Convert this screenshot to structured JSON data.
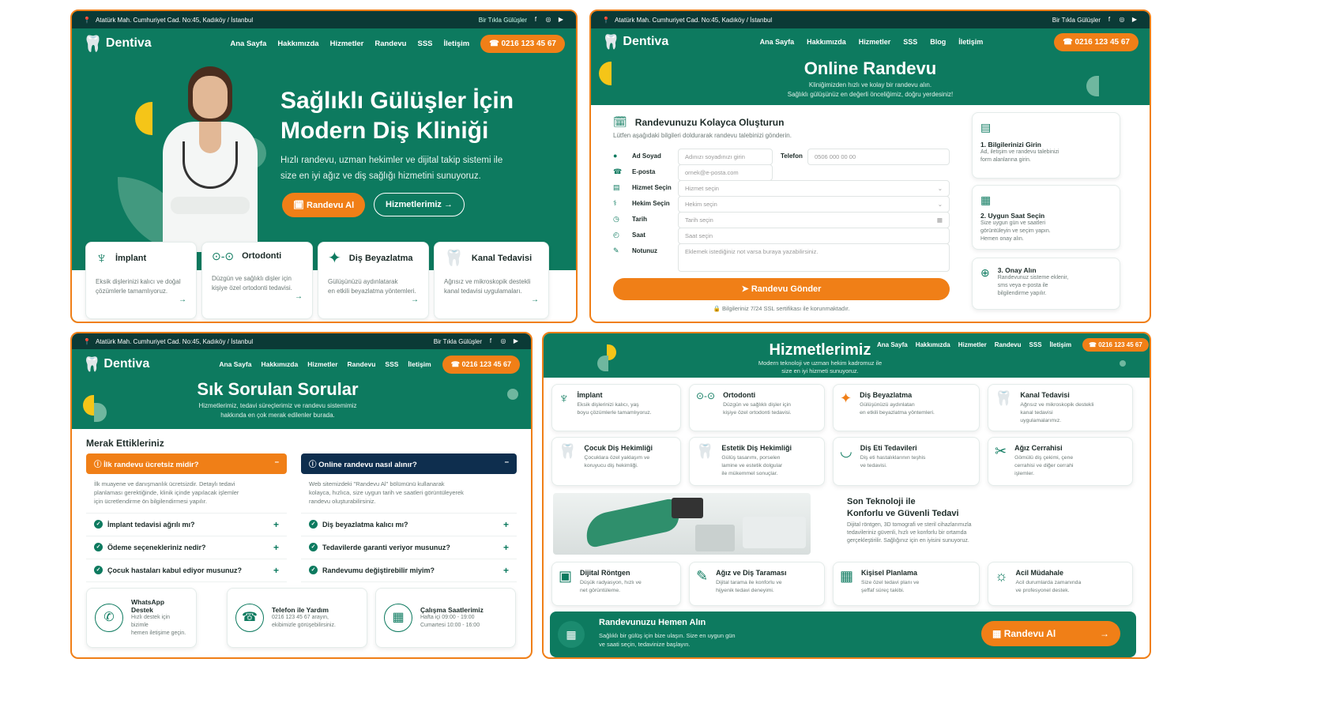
{
  "topbar": {
    "address": "Atatürk Mah. Cumhuriyet Cad. No:45, Kadıköy / İstanbul",
    "slogan": "Bir Tıkla Gülüşler"
  },
  "brand": "Dentiva",
  "phone": "0216 123 45 67",
  "nav1": [
    "Ana Sayfa",
    "Hakkımızda",
    "Hizmetler",
    "Randevu",
    "SSS",
    "İletişim"
  ],
  "nav2": [
    "Ana Sayfa",
    "Hakkımızda",
    "Hizmetler",
    "SSS",
    "Blog",
    "İletişim"
  ],
  "hero": {
    "title1": "Sağlıklı Gülüşler İçin",
    "title2": "Modern Diş Kliniği",
    "desc1": "Hızlı randevu, uzman hekimler ve dijital takip sistemi ile",
    "desc2": "size en iyi ağız ve diş sağlığı hizmetini sunuyoruz.",
    "btn1": "Randevu Al",
    "btn2": "Hizmetlerimiz"
  },
  "hero_cards": [
    {
      "title": "İmplant",
      "d1": "Eksik dişlerinizi kalıcı ve doğal",
      "d2": "çözümlerle tamamlıyoruz."
    },
    {
      "title": "Ortodonti",
      "d1": "Düzgün ve sağlıklı dişler için",
      "d2": "kişiye özel ortodonti tedavisi."
    },
    {
      "title": "Diş Beyazlatma",
      "d1": "Gülüşünüzü aydınlatarak",
      "d2": "en etkili beyazlatma yöntemleri."
    },
    {
      "title": "Kanal Tedavisi",
      "d1": "Ağrısız ve mikroskopik destekli",
      "d2": "kanal tedavisi uygulamaları."
    }
  ],
  "appt": {
    "title": "Online Randevu",
    "sub1": "Kliniğimizden hızlı ve kolay bir randevu alın.",
    "sub2": "Sağlıklı gülüşünüz en değerli önceliğimiz, doğru yerdesiniz!",
    "form_title": "Randevunuzu Kolayca Oluşturun",
    "form_sub": "Lütfen aşağıdaki bilgileri doldurarak randevu talebinizi gönderin.",
    "l_name": "Ad Soyad",
    "p_name": "Adınızı soyadınızı girin",
    "l_phone": "Telefon",
    "p_phone": "0506 000 00 00",
    "l_email": "E-posta",
    "p_email": "ornek@e-posta.com",
    "l_service": "Hizmet Seçin",
    "p_service": "Hizmet seçin",
    "l_doctor": "Hekim Seçin",
    "p_doctor": "Hekim seçin",
    "l_date": "Tarih",
    "p_date": "Tarih seçin",
    "l_time": "Saat",
    "p_time": "Saat seçin",
    "l_note": "Notunuz",
    "p_note": "Eklemek istediğiniz not varsa buraya yazabilirsiniz.",
    "submit": "Randevu Gönder",
    "ssl": "Bilgileriniz 7/24 SSL sertifikası ile korunmaktadır.",
    "steps": [
      {
        "t": "1. Bilgilerinizi Girin",
        "d1": "Ad, iletişim ve randevu talebinizi",
        "d2": "form alanlarına girin.",
        "d3": ""
      },
      {
        "t": "2. Uygun Saat Seçin",
        "d1": "Size uygun gün ve saatleri",
        "d2": "görüntüleyin ve seçim yapın.",
        "d3": "Hemen onay alın."
      },
      {
        "t": "3. Onay Alın",
        "d1": "Randevunuz sisteme eklenir,",
        "d2": "sms veya e-posta ile",
        "d3": "bilgilendirme yapılır."
      }
    ]
  },
  "faq": {
    "title": "Sık Sorulan Sorular",
    "sub1": "Hizmetlerimiz, tedavi süreçlerimiz ve randevu sistemimiz",
    "sub2": "hakkında en çok merak edilenler burada.",
    "section": "Merak Ettikleriniz",
    "q1": "İlk randevu ücretsiz midir?",
    "a1_1": "İlk muayene ve danışmanlık ücretsizdir. Detaylı tedavi",
    "a1_2": "planlaması gerektiğinde, klinik içinde yapılacak işlemler",
    "a1_3": "için ücretlendirme ön bilgilendirmesi yapılır.",
    "q2": "Online randevu nasıl alınır?",
    "a2_1": "Web sitemizdeki \"Randevu Al\" bölümünü kullanarak",
    "a2_2": "kolayca, hızlıca, size uygun tarih ve saatleri görüntüleyerek",
    "a2_3": "randevu oluşturabilirsiniz.",
    "left": [
      "İmplant tedavisi ağrılı mı?",
      "Ödeme seçenekleriniz nedir?",
      "Çocuk hastaları kabul ediyor musunuz?"
    ],
    "right": [
      "Diş beyazlatma kalıcı mı?",
      "Tedavilerde garanti veriyor musunuz?",
      "Randevumu değiştirebilir miyim?"
    ],
    "c1t": "WhatsApp Destek",
    "c1a": "Hızlı destek için bizimle",
    "c1b": "hemen iletişime geçin.",
    "c2t": "Telefon ile Yardım",
    "c2a": "0216 123 45 67 arayın,",
    "c2b": "ekibimizle görüşebilirsiniz.",
    "c3t": "Çalışma Saatlerimiz",
    "c3a": "Hafta içi 09:00 - 19:00",
    "c3b": "Cumartesi 10:00 - 16:00"
  },
  "svc": {
    "title": "Hizmetlerimiz",
    "sub1": "Modern teknoloji ve uzman hekim kadromuz ile",
    "sub2": "size en iyi hizmeti sunuyoruz.",
    "nav": [
      "Ana Sayfa",
      "Hakkımızda",
      "Hizmetler",
      "Randevu",
      "SSS",
      "İletişim"
    ],
    "items": [
      {
        "t": "İmplant",
        "d1": "Eksik dişlerinizi kalıcı, yaş",
        "d2": "boyu çözümlerle tamamlıyoruz.",
        "d3": ""
      },
      {
        "t": "Ortodonti",
        "d1": "Düzgün ve sağlıklı dişler için",
        "d2": "kişiye özel ortodonti tedavisi.",
        "d3": ""
      },
      {
        "t": "Diş Beyazlatma",
        "d1": "Gülüşünüzü aydınlatan",
        "d2": "en etkili beyazlatma yöntemleri.",
        "d3": ""
      },
      {
        "t": "Kanal Tedavisi",
        "d1": "Ağrısız ve mikroskopik destekli",
        "d2": "kanal tedavisi",
        "d3": "uygulamalarımız."
      },
      {
        "t": "Çocuk Diş Hekimliği",
        "d1": "Çocuklara özel yaklaşım ve",
        "d2": "koruyucu diş hekimliği.",
        "d3": ""
      },
      {
        "t": "Estetik Diş Hekimliği",
        "d1": "Gülüş tasarımı, porselen",
        "d2": "lamine ve estetik dolgular",
        "d3": "ile mükemmel sonuçlar."
      },
      {
        "t": "Diş Eti Tedavileri",
        "d1": "Diş eti hastalıklarının teşhis",
        "d2": "ve tedavisi.",
        "d3": ""
      },
      {
        "t": "Ağız Cerrahisi",
        "d1": "Gömülü diş çekimi, çene",
        "d2": "cerrahisi ve diğer cerrahi",
        "d3": "işlemler."
      }
    ],
    "tech_t1": "Son Teknoloji ile",
    "tech_t2": "Konforlu ve Güvenli Tedavi",
    "tech_d1": "Dijital röntgen, 3D tomografi ve steril cihazlarımızla",
    "tech_d2": "tedavileriniz güvenli, hızlı ve konforlu bir ortamda",
    "tech_d3": "gerçekleştirilir. Sağlığınız için en iyisini sunuyoruz.",
    "items2": [
      {
        "t": "Dijital Röntgen",
        "d1": "Düşük radyasyon, hızlı ve",
        "d2": "net görüntüleme."
      },
      {
        "t": "Ağız ve Diş Taraması",
        "d1": "Dijital tarama ile konforlu ve",
        "d2": "hijyenik tedavi deneyimi."
      },
      {
        "t": "Kişisel Planlama",
        "d1": "Size özel tedavi planı ve",
        "d2": "şeffaf süreç takibi."
      },
      {
        "t": "Acil Müdahale",
        "d1": "Acil durumlarda zamanında",
        "d2": "ve profesyonel destek."
      }
    ],
    "cta_t": "Randevunuzu Hemen Alın",
    "cta_d1": "Sağlıklı bir gülüş için bize ulaşın. Size en uygun gün",
    "cta_d2": "ve saati seçin, tedavinize başlayın.",
    "cta_btn": "Randevu Al"
  },
  "colors": {
    "green": "#0d7a5f",
    "dark": "#0b3a36",
    "orange": "#f07f17",
    "yellow": "#f5c518",
    "navy": "#0e2e4e"
  }
}
